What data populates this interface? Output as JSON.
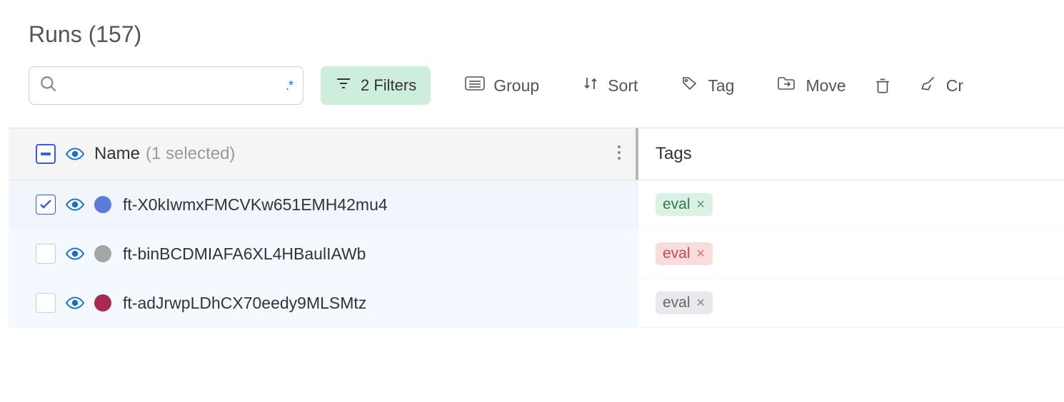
{
  "title": "Runs (157)",
  "toolbar": {
    "search_placeholder": "",
    "regex_hint": ".*",
    "filters_label": "2 Filters",
    "group_label": "Group",
    "sort_label": "Sort",
    "tag_label": "Tag",
    "move_label": "Move",
    "create_label": "Cr"
  },
  "columns": {
    "name": "Name",
    "name_sub": "(1 selected)",
    "tags": "Tags"
  },
  "rows": [
    {
      "checked": true,
      "dot": "#5b7bd5",
      "name": "ft-X0kIwmxFMCVKw651EMH42mu4",
      "tag_text": "eval",
      "tag_class": "tag-green"
    },
    {
      "checked": false,
      "dot": "#a6a6a6",
      "name": "ft-binBCDMIAFA6XL4HBaulIAWb",
      "tag_text": "eval",
      "tag_class": "tag-red"
    },
    {
      "checked": false,
      "dot": "#a62a54",
      "name": "ft-adJrwpLDhCX70eedy9MLSMtz",
      "tag_text": "eval",
      "tag_class": "tag-gray"
    }
  ]
}
